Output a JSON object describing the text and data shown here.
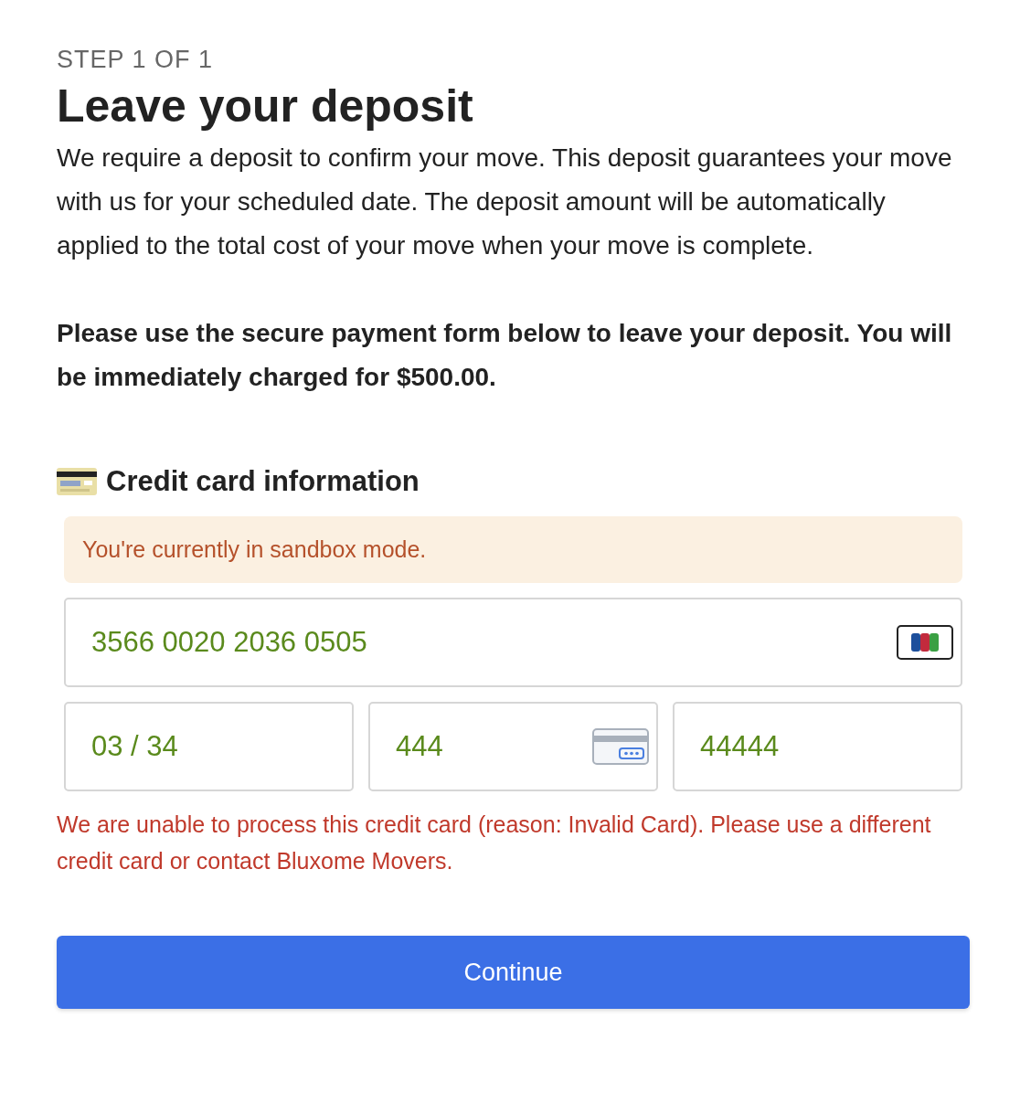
{
  "step": "STEP 1 OF 1",
  "title": "Leave your deposit",
  "intro": "We require a deposit to confirm your move. This deposit guarantees your move with us for your scheduled date. The deposit amount will be automatically applied to the total cost of your move when your move is complete.",
  "notice": "Please use the secure payment form below to leave your deposit. You will be immediately charged for $500.00.",
  "card_section": {
    "heading": "Credit card information",
    "sandbox_notice": "You're currently in sandbox mode.",
    "fields": [
      {
        "kind": "card_number",
        "value": "3566 0020 2036 0505",
        "valid": true
      },
      {
        "kind": "expiry",
        "value": "03 / 34",
        "valid": true
      },
      {
        "kind": "cvc",
        "value": "444",
        "valid": true
      },
      {
        "kind": "postal",
        "value": "44444",
        "valid": true
      }
    ],
    "error": "We are unable to process this credit card (reason: Invalid Card). Please use a different credit card or contact Bluxome Movers."
  },
  "continue_button": "Continue"
}
